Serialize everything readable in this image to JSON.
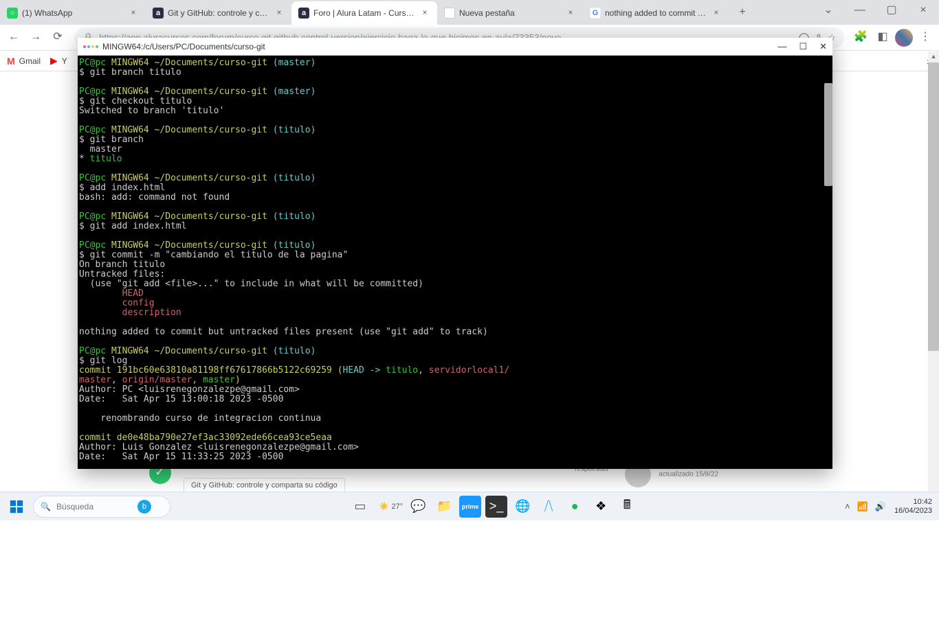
{
  "browser": {
    "tabs": [
      {
        "title": "(1) WhatsApp"
      },
      {
        "title": "Git y GitHub: controle y comp"
      },
      {
        "title": "Foro | Alura Latam - Cursos d",
        "active": true
      },
      {
        "title": "Nueva pestaña"
      },
      {
        "title": "nothing added to commit bu"
      }
    ],
    "url": "https://app.aluracursos.com/forum/curso-git-github-control-version/ejercicio-haga-lo-que-hicimos-en-aula/73353/novo",
    "bookmarks": [
      "Gmail",
      "Y"
    ]
  },
  "terminal": {
    "title": "MINGW64:/c/Users/PC/Documents/curso-git",
    "prompt_user": "PC@pc",
    "prompt_sys": "MINGW64",
    "prompt_path": "~/Documents/curso-git",
    "cmd_branch_titulo": "$ git branch titulo",
    "cmd_checkout": "$ git checkout titulo",
    "out_switched": "Switched to branch 'titulo'",
    "cmd_branch": "$ git branch",
    "out_master": "  master",
    "out_titulo_star_prefix": "* ",
    "out_titulo_star_name": "titulo",
    "cmd_add_bad": "$ add index.html",
    "out_bash_err": "bash: add: command not found",
    "cmd_git_add": "$ git add index.html",
    "cmd_commit": "$ git commit -m \"cambiando el titulo de la pagina\"",
    "out_onbranch": "On branch titulo",
    "out_untracked": "Untracked files:",
    "out_hint": "  (use \"git add <file>...\" to include in what will be committed)",
    "out_head": "        HEAD",
    "out_config": "        config",
    "out_desc": "        description",
    "out_nothing": "nothing added to commit but untracked files present (use \"git add\" to track)",
    "cmd_log": "$ git log",
    "log_commit1_prefix": "commit ",
    "log_commit1_hash": "191bc60e63810a81198ff67617866b5122c69259",
    "log_commit1_head_open": " (",
    "log_commit1_head": "HEAD -> ",
    "log_commit1_branch": "titulo",
    "log_commit1_sep": ", ",
    "log_commit1_remote": "servidorlocal1/",
    "log_commit1_line2a": "master",
    "log_commit1_line2sep": ", ",
    "log_commit1_line2b": "origin/master",
    "log_commit1_line2sep2": ", ",
    "log_commit1_line2c": "master",
    "log_commit1_close": ")",
    "log_author1": "Author: PC <luisrenegonzalezpe@gmail.com>",
    "log_date1": "Date:   Sat Apr 15 13:00:18 2023 -0500",
    "log_msg1": "    renombrando curso de integracion continua",
    "log_commit2": "commit de0e48ba790e27ef3ac33092ede66cea93ce5eaa",
    "log_author2": "Author: Luis Gonzalez <luisrenegonzalezpe@gmail.com>",
    "log_date2": "Date:   Sat Apr 15 11:33:25 2023 -0500",
    "branch_master": "(master)",
    "branch_titulo": "(titulo)"
  },
  "page": {
    "tag": "Git y GitHub: controle y comparta su código",
    "respuestas": "respuestas",
    "actualizado": "actualizado 15/8/22"
  },
  "taskbar": {
    "search_placeholder": "Búsqueda",
    "weather_temp": "27°",
    "time": "10:42",
    "date": "16/04/2023"
  }
}
